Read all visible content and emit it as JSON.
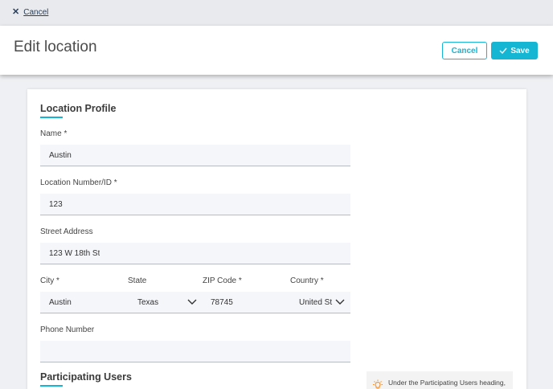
{
  "topbar": {
    "cancel_label": "Cancel"
  },
  "header": {
    "title": "Edit location",
    "cancel_label": "Cancel",
    "save_label": "Save"
  },
  "profile": {
    "title": "Location Profile",
    "name": {
      "label": "Name *",
      "value": "Austin"
    },
    "location_number": {
      "label": "Location Number/ID *",
      "value": "123"
    },
    "street": {
      "label": "Street Address",
      "value": "123 W 18th St"
    },
    "city": {
      "label": "City *",
      "value": "Austin"
    },
    "state": {
      "label": "State",
      "value": "Texas"
    },
    "zip": {
      "label": "ZIP Code *",
      "value": "78745"
    },
    "country": {
      "label": "Country *",
      "value": "United St"
    },
    "phone": {
      "label": "Phone Number",
      "value": ""
    }
  },
  "participating": {
    "title": "Participating Users"
  },
  "tip": {
    "text": "Under the Participating Users heading,"
  },
  "colors": {
    "accent": "#14b6d4",
    "field_bg": "#f5f6fa",
    "page_bg": "#eef0f3"
  }
}
